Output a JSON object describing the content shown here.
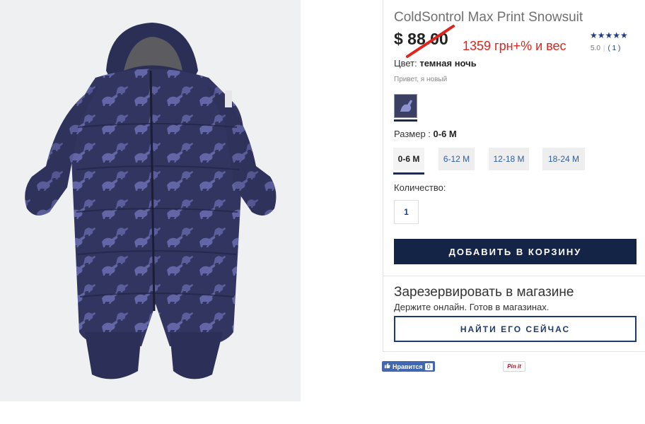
{
  "product": {
    "title": "ColdSontrol Max Print Snowsuit",
    "price": "$ 88.00",
    "price_note": "1359 грн+% и вес",
    "stars": "★★★★★",
    "rating_value": "5.0",
    "rating_count": "( 1 )",
    "image_description": "navy dinosaur print snowsuit"
  },
  "color": {
    "label": "Цвет:",
    "value": "темная ночь",
    "hint": "Привет, я новый",
    "swatch_color": "#3b3f63"
  },
  "size": {
    "label": "Размер :",
    "value": "0-6 M",
    "options": [
      "0-6 M",
      "6-12 M",
      "12-18 M",
      "18-24 M"
    ]
  },
  "quantity": {
    "label": "Количество:",
    "value": "1"
  },
  "actions": {
    "add_to_cart": "ДОБАВИТЬ В КОРЗИНУ",
    "find_now": "НАЙТИ ЕГО СЕЙЧАС"
  },
  "reserve": {
    "title": "Зарезервировать в магазине",
    "subtitle": "Держите онлайн. Готов в магазинах."
  },
  "social": {
    "like_label": "Нравится",
    "like_count": "0",
    "pin_label": "Pin it"
  },
  "colors": {
    "navy_button": "#132447",
    "note_red": "#e0231c",
    "star_blue": "#1d3e86"
  }
}
